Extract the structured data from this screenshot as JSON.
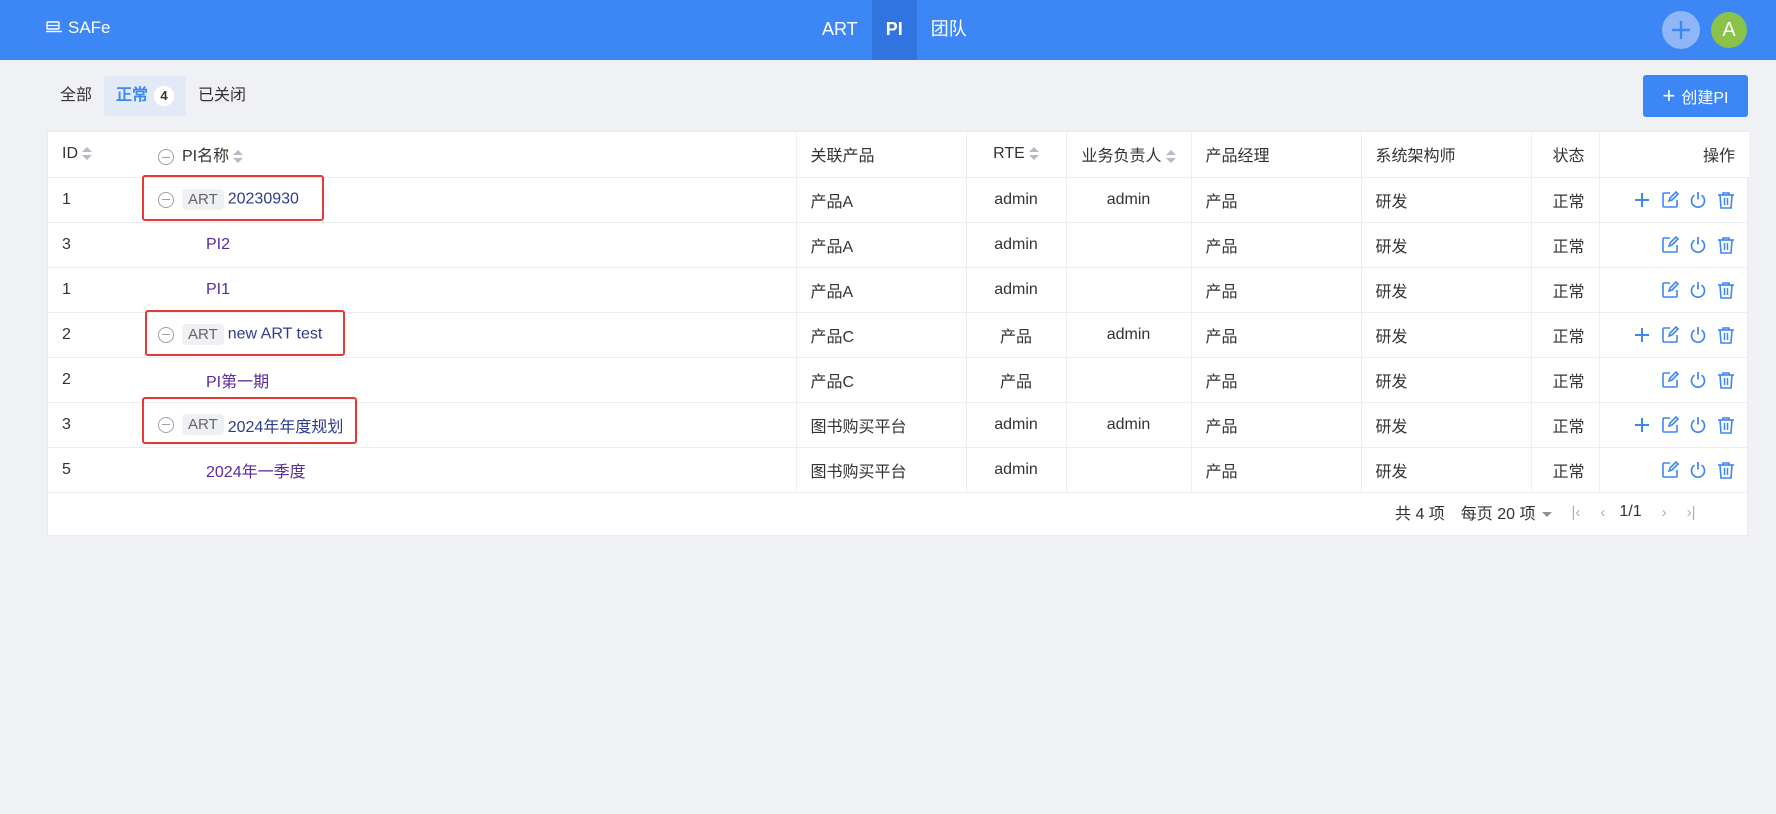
{
  "brand": {
    "name": "SAFe"
  },
  "nav": {
    "items": [
      {
        "label": "ART"
      },
      {
        "label": "PI"
      },
      {
        "label": "团队"
      }
    ]
  },
  "avatar": {
    "initial": "A"
  },
  "tabs": {
    "all": "全部",
    "normal": "正常",
    "normal_count": "4",
    "closed": "已关闭"
  },
  "create_button": {
    "label": "创建PI"
  },
  "table": {
    "headers": {
      "id": "ID",
      "name": "PI名称",
      "product": "关联产品",
      "rte": "RTE",
      "biz_owner": "业务负责人",
      "pm": "产品经理",
      "architect": "系统架构师",
      "status": "状态",
      "actions": "操作"
    },
    "rows": [
      {
        "id": "1",
        "tag": "ART",
        "name": "20230930",
        "product": "产品A",
        "rte": "admin",
        "biz_owner": "admin",
        "pm": "产品",
        "architect": "研发",
        "status": "正常"
      },
      {
        "id": "3",
        "name": "PI2",
        "product": "产品A",
        "rte": "admin",
        "biz_owner": "",
        "pm": "产品",
        "architect": "研发",
        "status": "正常"
      },
      {
        "id": "1",
        "name": "PI1",
        "product": "产品A",
        "rte": "admin",
        "biz_owner": "",
        "pm": "产品",
        "architect": "研发",
        "status": "正常"
      },
      {
        "id": "2",
        "tag": "ART",
        "name": "new ART test",
        "product": "产品C",
        "rte": "产品",
        "biz_owner": "admin",
        "pm": "产品",
        "architect": "研发",
        "status": "正常"
      },
      {
        "id": "2",
        "name": "PI第一期",
        "product": "产品C",
        "rte": "产品",
        "biz_owner": "",
        "pm": "产品",
        "architect": "研发",
        "status": "正常"
      },
      {
        "id": "3",
        "tag": "ART",
        "name": "2024年年度规划",
        "product": "图书购买平台",
        "rte": "admin",
        "biz_owner": "admin",
        "pm": "产品",
        "architect": "研发",
        "status": "正常"
      },
      {
        "id": "5",
        "name": "2024年一季度",
        "product": "图书购买平台",
        "rte": "admin",
        "biz_owner": "",
        "pm": "产品",
        "architect": "研发",
        "status": "正常"
      }
    ]
  },
  "pagination": {
    "total": "共 4 项",
    "page_size": "每页 20 项",
    "page": "1/1"
  },
  "colors": {
    "primary": "#3d86f6",
    "highlight_box": "#e53935",
    "child_link": "#5b2a9c",
    "parent_link": "#2c3c8f"
  }
}
